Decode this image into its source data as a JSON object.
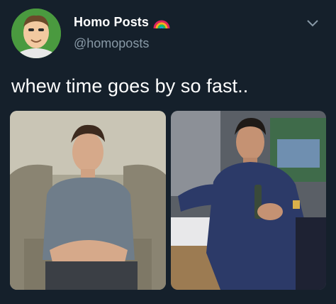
{
  "tweet": {
    "display_name": "Homo Posts",
    "handle": "@homoposts",
    "text": "whew time goes by so fast..",
    "icons": {
      "avatar": "cartoon-man-avatar",
      "name_emoji": "rainbow-icon",
      "menu": "chevron-down-icon"
    },
    "media": [
      {
        "name": "photo-then",
        "desc_icon": "photo"
      },
      {
        "name": "photo-now",
        "desc_icon": "photo"
      }
    ]
  },
  "colors": {
    "background": "#15202b",
    "text": "#ffffff",
    "secondary_text": "#8899a6"
  }
}
